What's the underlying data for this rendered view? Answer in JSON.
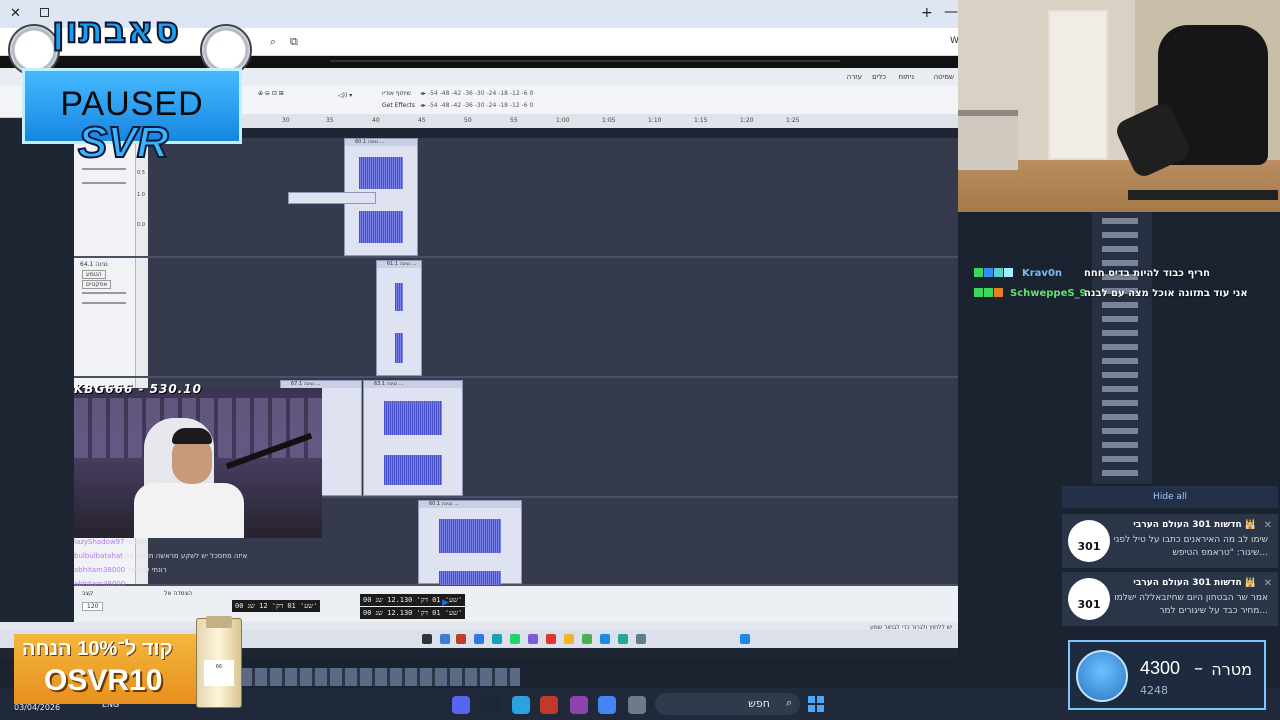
{
  "desktop": {
    "date": "03/04/2026",
    "lang": "ENG",
    "search_label": "חפש",
    "addr_right": "W"
  },
  "app": {
    "menu": [
      "שמיטה",
      "ניתוח",
      "כלים",
      "עזרה"
    ],
    "toolbar": {
      "get_effects": "Get Effects",
      "share_audio": "שיתוף אודיו"
    },
    "ruler_ticks": [
      "15",
      "20",
      "25",
      "30",
      "35",
      "40",
      "45",
      "50",
      "55",
      "1:00",
      "1:05",
      "1:10",
      "1:15",
      "1:20",
      "1:25"
    ],
    "clips": [
      {
        "title": "60.1 נגינה ..."
      },
      {
        "title": "61.1 נגינה ..."
      },
      {
        "title": "67.1 נגינה ..."
      },
      {
        "title": "63.1 נגינה ..."
      },
      {
        "title": "60.1 נגינה ..."
      }
    ],
    "track_names": [
      "64.1 נגינה",
      "הטמע",
      "אפקטים"
    ],
    "scale_values": [
      "1.0",
      "0.5",
      "0.0",
      "-0.5",
      "-1.0"
    ],
    "time_main": "00 שע' 01 דק' 12 שנ'",
    "time_sel_start": "00 שע' 01 דק' 12.130 שנ'",
    "time_sel_end": "00 שע' 01 דק' 12.130 שנ'",
    "rate_label": "קצב",
    "rate_value": "120",
    "snap_label": "הצמדה אל",
    "status_text": "יש ללחוץ ולגרור כדי לבחור שמע"
  },
  "overlay": {
    "logo_text": "סאבתון",
    "paused": "PAUSED",
    "svr": "SVR",
    "donation": "KBG666 - 530.10",
    "promo_line": "קוד ל־10% הנחה",
    "promo_code": "OSVR10",
    "bottle_label": "66"
  },
  "chat": [
    {
      "user": "Krav0n",
      "color": "#7fb8ff",
      "message": "חריף כבוד להיות בדיס חחח"
    },
    {
      "user": "SchweppeS_9",
      "color": "#5fe36a",
      "message": "אני עוד בתזונה אוכל מצה עם לבנה"
    }
  ],
  "mini_chat": [
    {
      "user": "lazyShadow97",
      "message": "חשבתי"
    },
    {
      "user": "bulbulbatahat",
      "message": "איזה מתסכל יש לשקע מראשה תוכנה לה"
    },
    {
      "user": "abhitam38000",
      "message": "רונתי עדיכאל"
    },
    {
      "user": "abhitam38000",
      "message": ""
    }
  ],
  "notifications": {
    "hide_all": "Hide all",
    "items": [
      {
        "logo": "301",
        "title": "חדשות 301 העולם הערבי 🕌",
        "body": "שימו לב מה האיראנים כתבו על טיל לפני שיגור: \"טראמפ הטיפש..."
      },
      {
        "logo": "301",
        "title": "חדשות 301 העולם הערבי 🕌",
        "body": "אמר שר הבטחון היום שחיזבאללה ישלמו מחיר כבד על שיגורים למר..."
      }
    ]
  },
  "goal": {
    "value": "4300",
    "label": "מטרה",
    "current": "4248"
  }
}
